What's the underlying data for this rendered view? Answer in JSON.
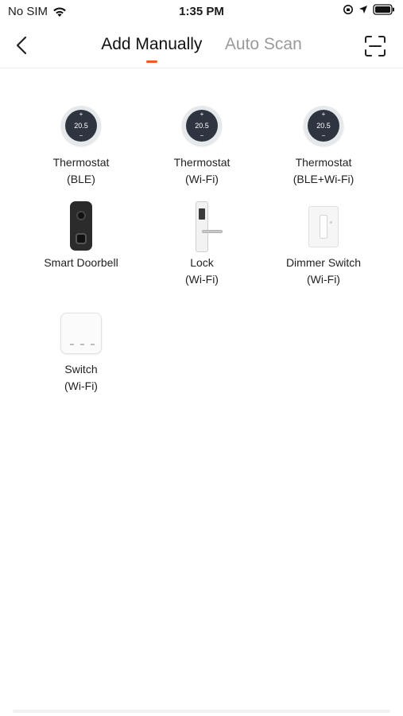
{
  "status_bar": {
    "carrier": "No SIM",
    "time": "1:35 PM",
    "icons": [
      "wifi-icon",
      "orientation-lock-icon",
      "location-arrow-icon",
      "battery-icon"
    ]
  },
  "nav": {
    "back_icon": "chevron-left-icon",
    "tabs": [
      {
        "label": "Add Manually",
        "active": true
      },
      {
        "label": "Auto Scan",
        "active": false
      }
    ],
    "scan_icon": "scan-frame-icon",
    "accent_color": "#f05a28"
  },
  "devices": [
    {
      "label_line1": "Thermostat",
      "label_line2": "(BLE)",
      "icon": "thermostat-icon",
      "display": "20.5"
    },
    {
      "label_line1": "Thermostat",
      "label_line2": "(Wi-Fi)",
      "icon": "thermostat-icon",
      "display": "20.5"
    },
    {
      "label_line1": "Thermostat",
      "label_line2": "(BLE+Wi-Fi)",
      "icon": "thermostat-icon",
      "display": "20.5"
    },
    {
      "label_line1": "Smart Doorbell",
      "label_line2": "",
      "icon": "doorbell-icon"
    },
    {
      "label_line1": "Lock",
      "label_line2": "(Wi-Fi)",
      "icon": "lock-icon"
    },
    {
      "label_line1": "Dimmer Switch",
      "label_line2": "(Wi-Fi)",
      "icon": "dimmer-switch-icon"
    },
    {
      "label_line1": "Switch",
      "label_line2": "(Wi-Fi)",
      "icon": "switch-icon"
    }
  ]
}
